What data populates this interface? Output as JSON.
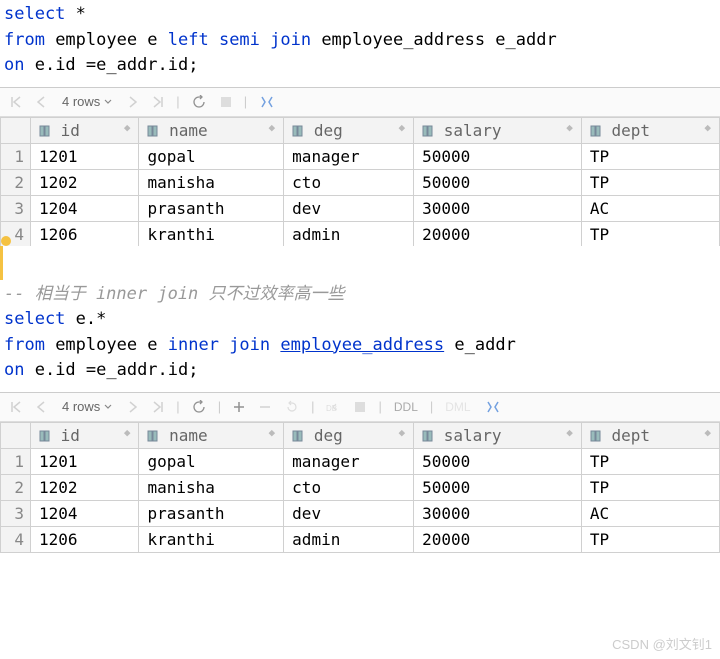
{
  "sql1": {
    "line1": {
      "kw1": "select",
      "rest": " *"
    },
    "line2": {
      "kw1": "from",
      "t1": " employee e ",
      "kw2": "left semi join",
      "t2": " employee_address e_addr"
    },
    "line3": {
      "kw1": "on",
      "rest": " e.id =e_addr.id;"
    }
  },
  "comment1": "-- 相当于 inner join  只不过效率高一些",
  "sql2": {
    "line1": {
      "kw1": "select",
      "rest": " e.*"
    },
    "line2": {
      "kw1": "from",
      "t1": " employee e ",
      "kw2": "inner join",
      "t2pre": " ",
      "link": "employee_address",
      "t2post": " e_addr"
    },
    "line3": {
      "kw1": "on",
      "rest": " e.id =e_addr.id;"
    }
  },
  "toolbar1": {
    "rows_label": "4 rows"
  },
  "toolbar2": {
    "rows_label": "4 rows",
    "ddl": "DDL",
    "dml": "DML"
  },
  "table_headers": {
    "id": "id",
    "name": "name",
    "deg": "deg",
    "salary": "salary",
    "dept": "dept"
  },
  "table1": {
    "rows": [
      {
        "n": "1",
        "id": "1201",
        "name": "gopal",
        "deg": "manager",
        "salary": "50000",
        "dept": "TP"
      },
      {
        "n": "2",
        "id": "1202",
        "name": "manisha",
        "deg": "cto",
        "salary": "50000",
        "dept": "TP"
      },
      {
        "n": "3",
        "id": "1204",
        "name": "prasanth",
        "deg": "dev",
        "salary": "30000",
        "dept": "AC"
      },
      {
        "n": "4",
        "id": "1206",
        "name": "kranthi",
        "deg": "admin",
        "salary": "20000",
        "dept": "TP"
      }
    ]
  },
  "table2": {
    "rows": [
      {
        "n": "1",
        "id": "1201",
        "name": "gopal",
        "deg": "manager",
        "salary": "50000",
        "dept": "TP"
      },
      {
        "n": "2",
        "id": "1202",
        "name": "manisha",
        "deg": "cto",
        "salary": "50000",
        "dept": "TP"
      },
      {
        "n": "3",
        "id": "1204",
        "name": "prasanth",
        "deg": "dev",
        "salary": "30000",
        "dept": "AC"
      },
      {
        "n": "4",
        "id": "1206",
        "name": "kranthi",
        "deg": "admin",
        "salary": "20000",
        "dept": "TP"
      }
    ]
  },
  "watermark": "CSDN @刘文钊1"
}
